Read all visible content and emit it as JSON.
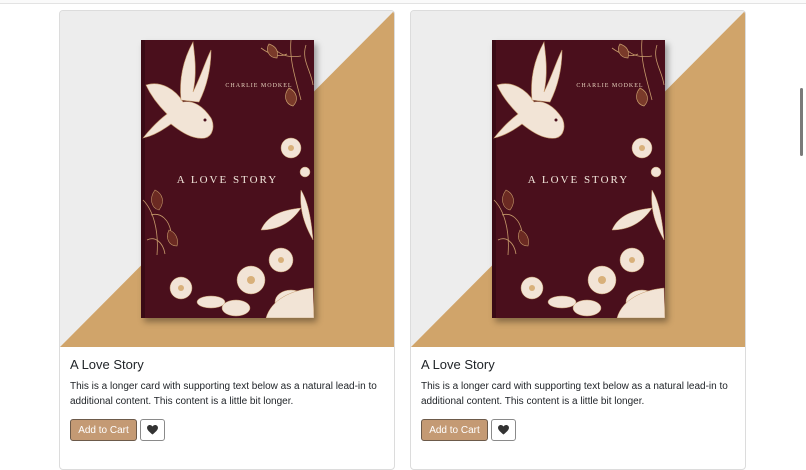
{
  "products": [
    {
      "title": "A Love Story",
      "description": "This is a longer card with supporting text below as a natural lead-in to additional content. This content is a little bit longer.",
      "cover": {
        "author": "CHARLIE MODKEL",
        "title": "A LOVE STORY"
      },
      "add_to_cart_label": "Add to Cart",
      "favorite_icon": "heart-icon"
    },
    {
      "title": "A Love Story",
      "description": "This is a longer card with supporting text below as a natural lead-in to additional content. This content is a little bit longer.",
      "cover": {
        "author": "CHARLIE MODKEL",
        "title": "A LOVE STORY"
      },
      "add_to_cart_label": "Add to Cart",
      "favorite_icon": "heart-icon"
    }
  ],
  "colors": {
    "image_background": "#ededed",
    "image_accent": "#d0a46a",
    "book_cover": "#4a0f1c",
    "cart_button": "#c49a74"
  }
}
